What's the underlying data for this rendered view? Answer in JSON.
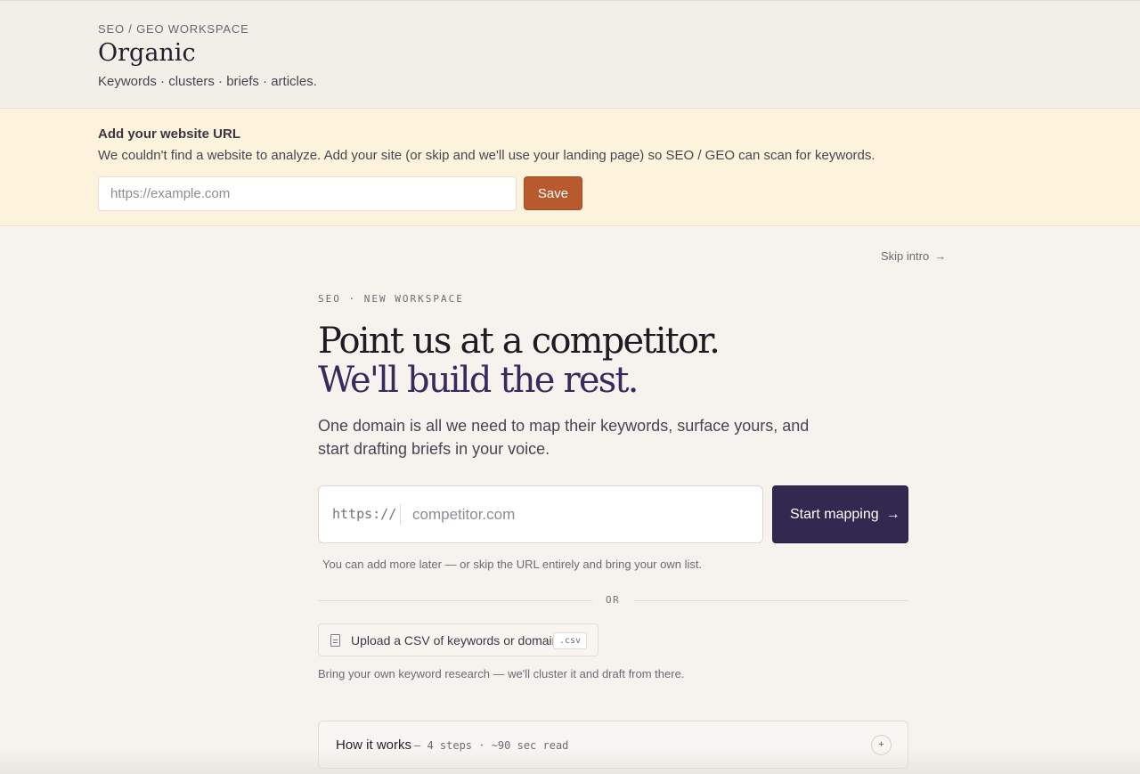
{
  "header": {
    "eyebrow": "SEO / GEO WORKSPACE",
    "title": "Organic",
    "subtitle": "Keywords · clusters · briefs · articles."
  },
  "banner": {
    "title": "Add your website URL",
    "text": "We couldn't find a website to analyze. Add your site (or skip and we'll use your landing page) so SEO / GEO can scan for keywords.",
    "url_placeholder": "https://example.com",
    "url_value": "",
    "save_label": "Save"
  },
  "intro": {
    "skip_label": "Skip intro",
    "skip_arrow": "→",
    "kicker": "SEO · NEW WORKSPACE",
    "headline_line1": "Point us at a competitor.",
    "headline_line2": "We'll build the rest.",
    "lede": "One domain is all we need to map their keywords, surface yours, and start drafting briefs in your voice.",
    "domain_prefix": "https://",
    "domain_placeholder": "competitor.com",
    "domain_value": "",
    "start_label": "Start mapping",
    "start_arrow": "→",
    "hint": "You can add more later — or skip the URL entirely and bring your own list.",
    "or_label": "OR",
    "upload_label": "Upload a CSV of keywords or domains",
    "upload_badge": ".csv",
    "upload_hint": "Bring your own keyword research — we'll cluster it and draft from there.",
    "how_title": "How it works",
    "how_meta": "— 4 steps · ~90 sec read",
    "how_toggle": "+"
  },
  "colors": {
    "accent": "#b85a2e",
    "primary": "#33284f",
    "banner_bg": "#fdf3dc",
    "page_bg": "#f6f3ee"
  },
  "icons": {
    "upload": "document-icon",
    "skip": "arrow-right-icon",
    "start": "arrow-right-icon",
    "how": "plus-icon"
  }
}
